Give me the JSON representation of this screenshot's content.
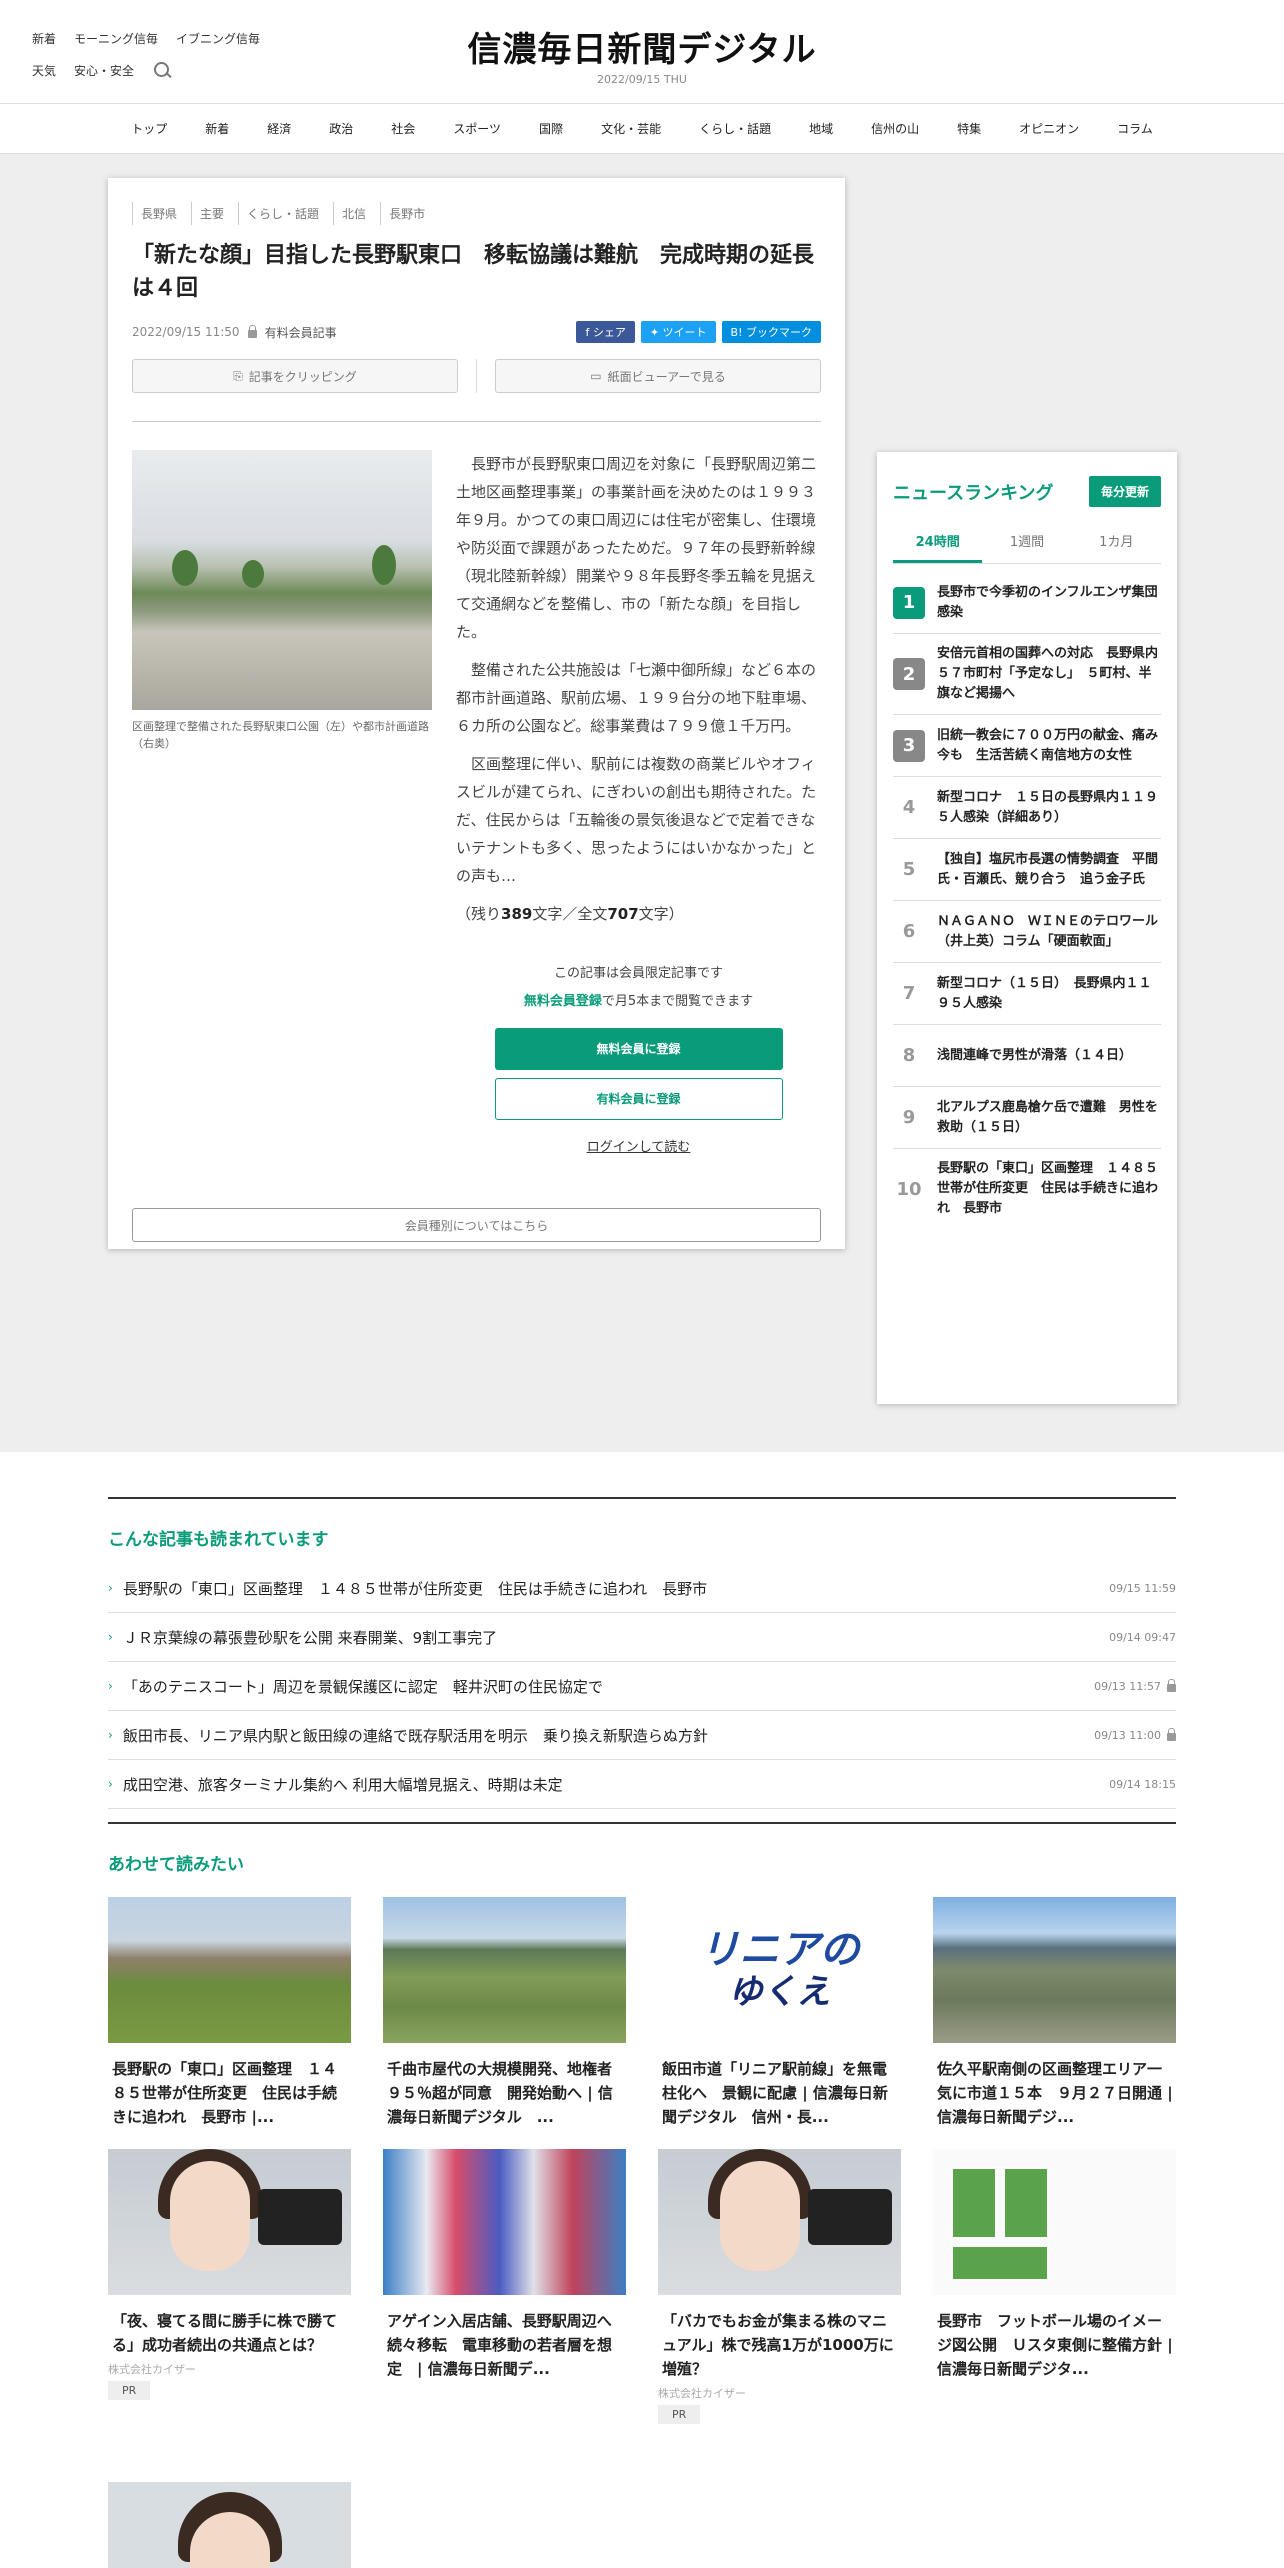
{
  "header": {
    "links_row1": [
      "新着",
      "モーニング信毎",
      "イブニング信毎"
    ],
    "links_row2": [
      "天気",
      "安心・安全"
    ],
    "logo": "信濃毎日新聞デジタル",
    "date": "2022/09/15 THU"
  },
  "nav": [
    "トップ",
    "新着",
    "経済",
    "政治",
    "社会",
    "スポーツ",
    "国際",
    "文化・芸能",
    "くらし・話題",
    "地域",
    "信州の山",
    "特集",
    "オピニオン",
    "コラム"
  ],
  "article": {
    "tags": [
      "長野県",
      "主要",
      "くらし・話題",
      "北信",
      "長野市"
    ],
    "headline": "「新たな顔」目指した長野駅東口　移転協議は難航　完成時期の延長は４回",
    "datetime": "2022/09/15 11:50",
    "member_label": "有料会員記事",
    "share": [
      "シェア",
      "ツイート",
      "ブックマーク"
    ],
    "tools": [
      "記事をクリッピング",
      "紙面ビューアーで見る"
    ],
    "caption": "区画整理で整備された長野駅東口公園（左）や都市計画道路（右奥）",
    "paragraphs": [
      "長野市が長野駅東口周辺を対象に「長野駅周辺第二土地区画整理事業」の事業計画を決めたのは１９９３年９月。かつての東口周辺には住宅が密集し、住環境や防災面で課題があったためだ。９７年の長野新幹線（現北陸新幹線）開業や９８年長野冬季五輪を見据えて交通網などを整備し、市の「新たな顔」を目指した。",
      "整備された公共施設は「七瀬中御所線」など６本の都市計画道路、駅前広場、１９９台分の地下駐車場、６カ所の公園など。総事業費は７９９億１千万円。",
      "区画整理に伴い、駅前には複数の商業ビルやオフィスビルが建てられ、にぎわいの創出も期待された。ただ、住民からは「五輪後の景気後退などで定着できないテナントも多く、思ったようにはいかなかった」との声も…"
    ],
    "count_prefix": "（残り",
    "remaining": "389",
    "count_mid": "文字／全文",
    "total": "707",
    "count_suffix": "文字）",
    "paywall_line1": "この記事は会員限定記事です",
    "paywall_link": "無料会員登録",
    "paywall_line2": "で月5本まで閲覧できます",
    "btn_free": "無料会員に登録",
    "btn_paid": "有料会員に登録",
    "login": "ログインして読む",
    "member_types": "会員種別についてはこちら"
  },
  "ranking": {
    "title": "ニュースランキング",
    "update": "毎分更新",
    "tabs": [
      "24時間",
      "1週間",
      "1カ月"
    ],
    "items": [
      {
        "n": "1",
        "t": "長野市で今季初のインフルエンザ集団感染"
      },
      {
        "n": "2",
        "t": "安倍元首相の国葬への対応　長野県内５７市町村「予定なし」　５町村、半旗など掲揚へ"
      },
      {
        "n": "3",
        "t": "旧統一教会に７００万円の献金、痛み今も　生活苦続く南信地方の女性"
      },
      {
        "n": "4",
        "t": "新型コロナ　１５日の長野県内１１９５人感染（詳細あり）"
      },
      {
        "n": "5",
        "t": "【独自】塩尻市長選の情勢調査　平間氏・百瀬氏、競り合う　追う金子氏"
      },
      {
        "n": "6",
        "t": "ＮＡＧＡＮＯ　ＷＩＮＥのテロワール（井上英）コラム「硬面軟面」"
      },
      {
        "n": "7",
        "t": "新型コロナ（１５日）　長野県内１１９５人感染"
      },
      {
        "n": "8",
        "t": "浅間連峰で男性が滑落（１４日）"
      },
      {
        "n": "9",
        "t": "北アルプス鹿島槍ケ岳で遭難　男性を救助（１５日）"
      },
      {
        "n": "10",
        "t": "長野駅の「東口」区画整理　１４８５世帯が住所変更　住民は手続きに追われ　長野市"
      }
    ]
  },
  "read": {
    "title": "こんな記事も読まれています",
    "items": [
      {
        "t": "長野駅の「東口」区画整理　１４８５世帯が住所変更　住民は手続きに追われ　長野市",
        "d": "09/15 11:59",
        "lock": false
      },
      {
        "t": "ＪＲ京葉線の幕張豊砂駅を公開 来春開業、9割工事完了",
        "d": "09/14 09:47",
        "lock": false
      },
      {
        "t": "「あのテニスコート」周辺を景観保護区に認定　軽井沢町の住民協定で",
        "d": "09/13 11:57",
        "lock": true
      },
      {
        "t": "飯田市長、リニア県内駅と飯田線の連絡で既存駅活用を明示　乗り換え新駅造らぬ方針",
        "d": "09/13 11:00",
        "lock": true
      },
      {
        "t": "成田空港、旅客ターミナル集約へ 利用大幅増見据え、時期は未定",
        "d": "09/14 18:15",
        "lock": false
      }
    ]
  },
  "also": {
    "title": "あわせて読みたい",
    "cards": [
      {
        "t": "長野駅の「東口」区画整理　１４８５世帯が住所変更　住民は手続きに追われ　長野市 |...",
        "src": "",
        "pr": ""
      },
      {
        "t": "千曲市屋代の大規模開発、地権者９５％超が同意　開発始動へ | 信濃毎日新聞デジタル　...",
        "src": "",
        "pr": ""
      },
      {
        "t": "飯田市道「リニア駅前線」を無電柱化へ　景観に配慮 | 信濃毎日新聞デジタル　信州・長...",
        "src": "",
        "pr": ""
      },
      {
        "t": "佐久平駅南側の区画整理エリア一気に市道１５本　９月２７日開通 | 信濃毎日新聞デジ...",
        "src": "",
        "pr": ""
      },
      {
        "t": "「夜、寝てる間に勝手に株で勝てる」成功者続出の共通点とは？",
        "src": "株式会社カイザー",
        "pr": "PR"
      },
      {
        "t": "アゲイン入居店舗、長野駅周辺へ続々移転　電車移動の若者層を想定　| 信濃毎日新聞デ...",
        "src": "",
        "pr": ""
      },
      {
        "t": "「バカでもお金が集まる株のマニュアル」株で残高1万が1000万に増殖？",
        "src": "株式会社カイザー",
        "pr": "PR"
      },
      {
        "t": "長野市　フットボール場のイメージ図公開　Ｕスタ東側に整備方針 | 信濃毎日新聞デジタ...",
        "src": "",
        "pr": ""
      }
    ],
    "linear_a": "リニアの",
    "linear_b": "ゆくえ"
  },
  "colors": {
    "accent": "#0a9b7a",
    "facebook": "#3b5998",
    "twitter": "#1da1f2",
    "hatena": "#008fde"
  }
}
